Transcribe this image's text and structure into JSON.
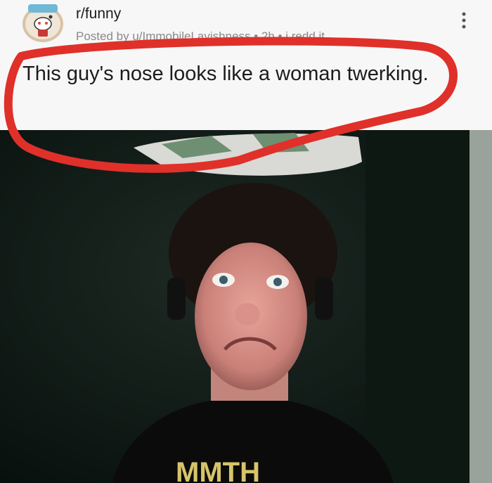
{
  "post": {
    "subreddit": "r/funny",
    "posted_by_prefix": "Posted by ",
    "username": "u/ImmobileLavishness",
    "time": " • 2h • ",
    "domain": "i.redd.it",
    "title": "This guy's nose looks like a woman twerking."
  },
  "icons": {
    "avatar": "reddit-snoo-avatar",
    "more": "vertical-ellipsis-icon"
  },
  "colors": {
    "annotation": "#e0302a",
    "header_bg": "#f7f7f7",
    "text": "#1c1c1c",
    "meta": "#8a8a8a"
  },
  "shirt_text": "MMTH"
}
